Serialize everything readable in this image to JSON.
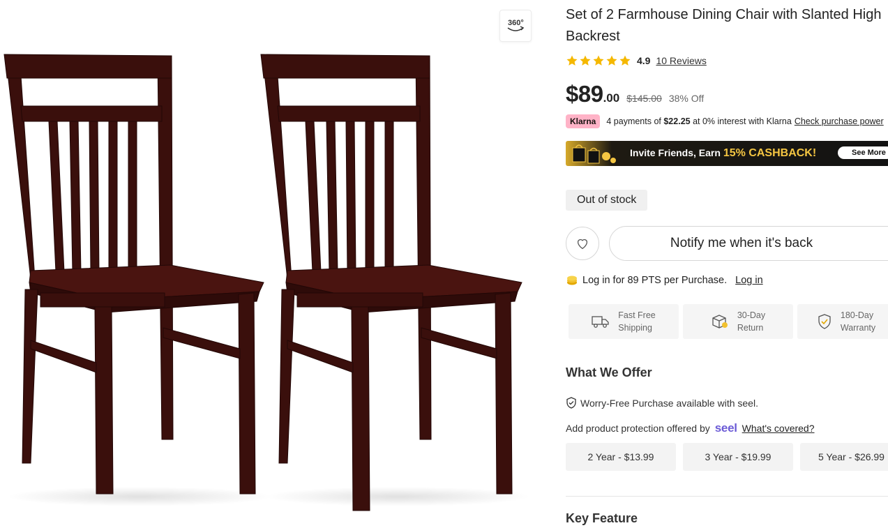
{
  "product": {
    "title": "Set of 2 Farmhouse Dining Chair with Slanted High Backrest",
    "rating": "4.9",
    "reviews": "10 Reviews",
    "star_color": "#f5b800"
  },
  "gallery": {
    "view_360_label": "360°"
  },
  "price": {
    "currency_whole": "$89",
    "cents": ".00",
    "original": "$145.00",
    "discount": "38% Off"
  },
  "klarna": {
    "badge": "Klarna",
    "text_prefix": "4 payments of",
    "amount": "$22.25",
    "text_suffix": "at 0% interest with Klarna",
    "link": "Check purchase power"
  },
  "banner": {
    "text_prefix": "Invite Friends, Earn ",
    "highlight": "15% CASHBACK!",
    "see_more": "See More"
  },
  "stock_status": "Out of stock",
  "notify_button": "Notify me when it's back",
  "points": {
    "text": "Log in for 89 PTS per Purchase.",
    "link": "Log in"
  },
  "perks": [
    {
      "line1": "Fast Free",
      "line2": "Shipping",
      "icon": "truck-icon"
    },
    {
      "line1": "30-Day",
      "line2": "Return",
      "icon": "return-box-icon"
    },
    {
      "line1": "180-Day",
      "line2": "Warranty",
      "icon": "shield-check-icon"
    }
  ],
  "offer": {
    "title": "What We Offer",
    "worry_free": "Worry-Free Purchase available with seel.",
    "protection_text": "Add product protection offered by",
    "seel_logo": "seel",
    "covered_link": "What's covered?",
    "plans": [
      "2 Year - $13.99",
      "3 Year - $19.99",
      "5 Year - $26.99"
    ]
  },
  "key_feature_title": "Key Feature"
}
